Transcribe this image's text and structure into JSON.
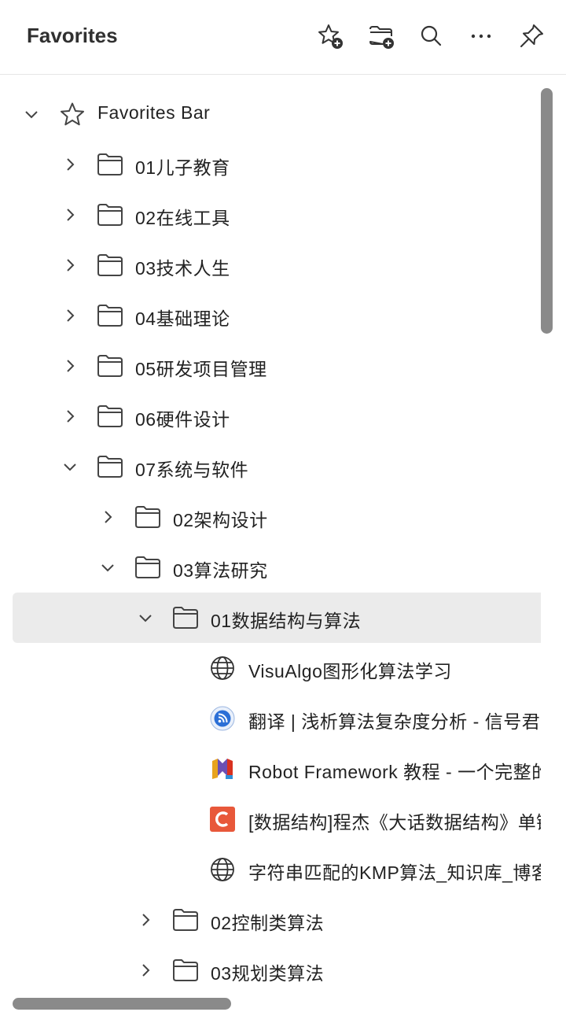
{
  "header": {
    "title": "Favorites",
    "buttons": {
      "add_favorite": "add-favorite-icon",
      "add_folder": "add-folder-icon",
      "search": "search-icon",
      "more": "more-icon",
      "pin": "pin-icon"
    }
  },
  "tree": {
    "root": {
      "label": "Favorites Bar",
      "expanded": true
    },
    "items": [
      {
        "label": "01儿子教育",
        "type": "folder",
        "expanded": false
      },
      {
        "label": "02在线工具",
        "type": "folder",
        "expanded": false
      },
      {
        "label": "03技术人生",
        "type": "folder",
        "expanded": false
      },
      {
        "label": "04基础理论",
        "type": "folder",
        "expanded": false
      },
      {
        "label": "05研发项目管理",
        "type": "folder",
        "expanded": false
      },
      {
        "label": "06硬件设计",
        "type": "folder",
        "expanded": false
      },
      {
        "label": "07系统与软件",
        "type": "folder",
        "expanded": true
      },
      {
        "label": "02架构设计",
        "type": "folder",
        "expanded": false
      },
      {
        "label": "03算法研究",
        "type": "folder",
        "expanded": true
      },
      {
        "label": "01数据结构与算法",
        "type": "folder",
        "expanded": true,
        "selected": true
      },
      {
        "label": "VisuAlgo图形化算法学习",
        "type": "link",
        "icon": "globe-icon"
      },
      {
        "label": "翻译 | 浅析算法复杂度分析 - 信号君",
        "type": "link",
        "icon": "rss-site-icon"
      },
      {
        "label": "Robot Framework 教程 - 一个完整的",
        "type": "link",
        "icon": "ml-site-icon"
      },
      {
        "label": "[数据结构]程杰《大话数据结构》单链",
        "type": "link",
        "icon": "c-site-icon"
      },
      {
        "label": "字符串匹配的KMP算法_知识库_博客",
        "type": "link",
        "icon": "globe-icon"
      },
      {
        "label": "02控制类算法",
        "type": "folder",
        "expanded": false
      },
      {
        "label": "03规划类算法",
        "type": "folder",
        "expanded": false
      }
    ]
  },
  "colors": {
    "selected_bg": "#ebebeb",
    "scrollbar": "#8a8a8a",
    "rss_blue": "#2b6fd6",
    "c_orange": "#e8583a"
  }
}
